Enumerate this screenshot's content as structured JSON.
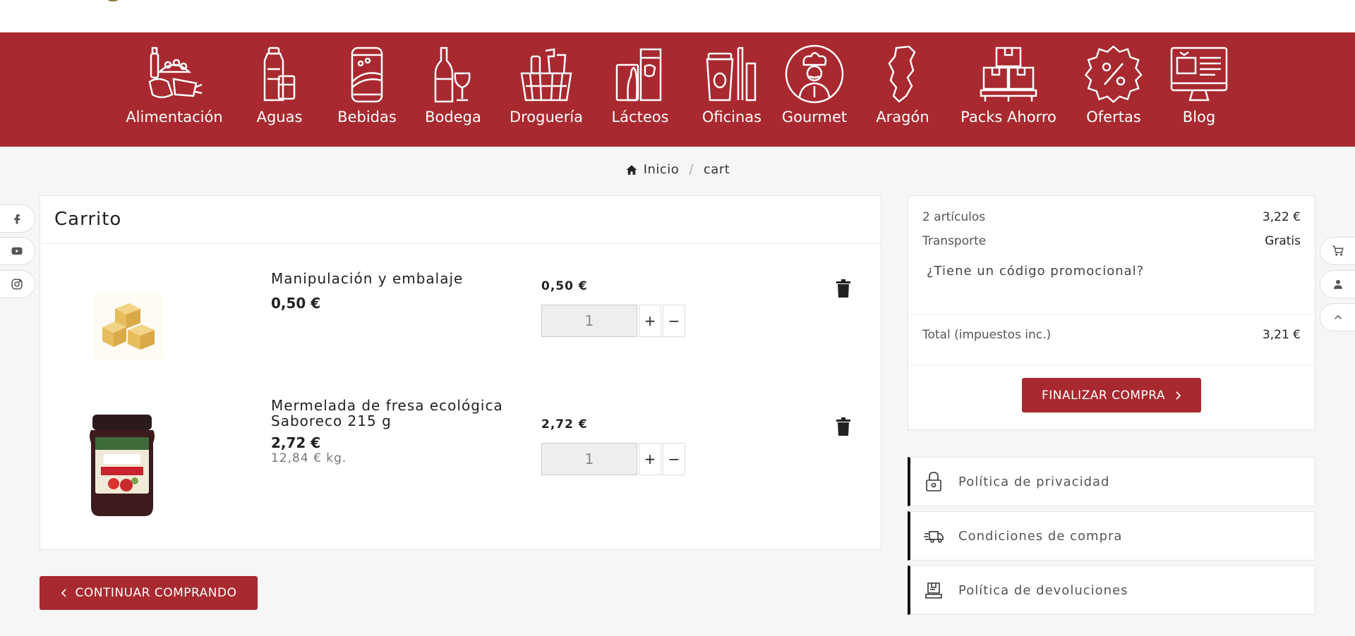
{
  "nav": {
    "categories": [
      {
        "label": "Alimentación",
        "icon": "groceries-icon"
      },
      {
        "label": "Aguas",
        "icon": "water-bottle-icon"
      },
      {
        "label": "Bebidas",
        "icon": "soda-can-icon"
      },
      {
        "label": "Bodega",
        "icon": "wine-icon"
      },
      {
        "label": "Droguería",
        "icon": "cleaning-basket-icon"
      },
      {
        "label": "Lácteos",
        "icon": "dairy-icon"
      },
      {
        "label": "Oficinas",
        "icon": "office-coffee-icon"
      },
      {
        "label": "Gourmet",
        "icon": "chef-icon"
      },
      {
        "label": "Aragón",
        "icon": "aragon-map-icon"
      },
      {
        "label": "Packs Ahorro",
        "icon": "boxes-pallet-icon"
      },
      {
        "label": "Ofertas",
        "icon": "discount-badge-icon"
      },
      {
        "label": "Blog",
        "icon": "blog-monitor-icon"
      }
    ]
  },
  "breadcrumb": {
    "home": "Inicio",
    "separator": "/",
    "current": "cart"
  },
  "cart": {
    "title": "Carrito",
    "items": [
      {
        "name": "Manipulación y embalaje",
        "price": "0,50 €",
        "unit_price": "",
        "line_price": "0,50 €",
        "quantity": "1",
        "thumb": "packaging-cubes-image"
      },
      {
        "name": "Mermelada de fresa ecológica Saboreco 215 g",
        "price": "2,72 €",
        "unit_price": "12,84 € kg.",
        "line_price": "2,72 €",
        "quantity": "1",
        "thumb": "strawberry-jam-jar-image"
      }
    ],
    "plus": "+",
    "minus": "−",
    "continue_label": "CONTINUAR COMPRANDO"
  },
  "summary": {
    "items_label": "2 artículos",
    "items_value": "3,22 €",
    "shipping_label": "Transporte",
    "shipping_value": "Gratis",
    "promo_label": "¿Tiene un código promocional?",
    "total_label": "Total (impuestos inc.)",
    "total_value": "3,21 €",
    "checkout_label": "FINALIZAR COMPRA"
  },
  "policies": [
    {
      "label": "Política de privacidad",
      "icon": "padlock-icon"
    },
    {
      "label": "Condiciones de compra",
      "icon": "delivery-truck-icon"
    },
    {
      "label": "Política de devoluciones",
      "icon": "return-box-icon"
    }
  ],
  "colors": {
    "brand": "#a8292f",
    "background": "#f6f6f6"
  }
}
